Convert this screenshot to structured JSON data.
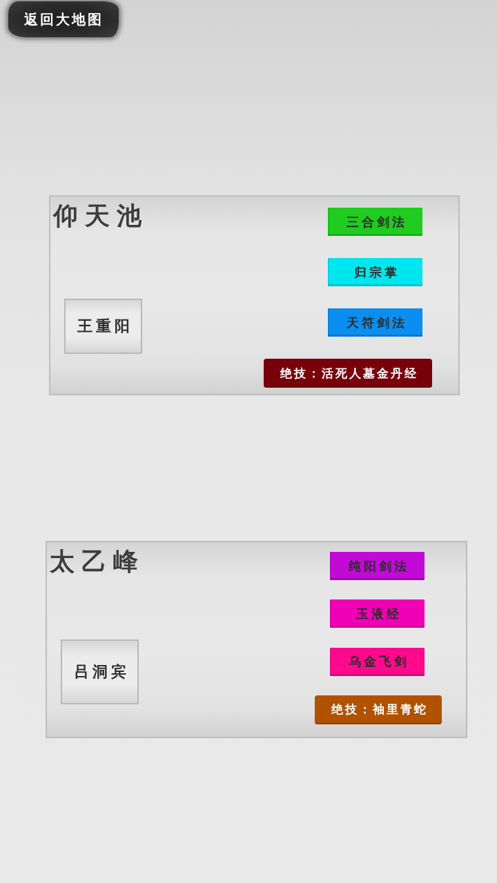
{
  "back_button": {
    "label": "返回大地图"
  },
  "sects": [
    {
      "name": "仰天池",
      "master": "王重阳",
      "skills": [
        {
          "label": "三合剑法",
          "color": "#1fcc1f"
        },
        {
          "label": "归宗掌",
          "color": "#00e6ee"
        },
        {
          "label": "天符剑法",
          "color": "#0a8ef0"
        }
      ],
      "ultimate": {
        "label": "绝技：活死人墓金丹经",
        "color": "#78000a"
      }
    },
    {
      "name": "太乙峰",
      "master": "吕洞宾",
      "skills": [
        {
          "label": "纯阳剑法",
          "color": "#c20ad6"
        },
        {
          "label": "玉液经",
          "color": "#f000b4"
        },
        {
          "label": "乌金飞剑",
          "color": "#ff0a8c"
        }
      ],
      "ultimate": {
        "label": "绝技：袖里青蛇",
        "color": "#b05200"
      }
    }
  ]
}
